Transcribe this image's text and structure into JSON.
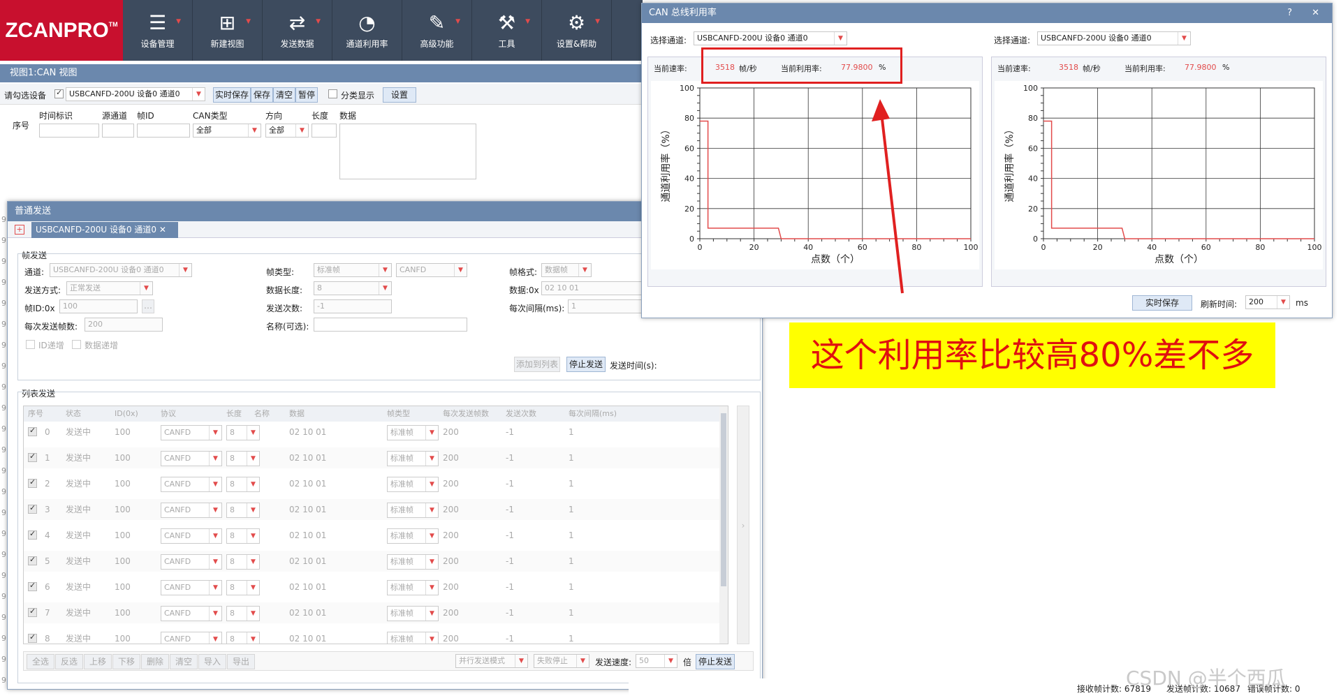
{
  "app": {
    "logo": "ZCANPRO",
    "tm": "TM"
  },
  "toolbar": [
    {
      "label": "设备管理",
      "icon": "device-manage-icon",
      "glyph": "☰"
    },
    {
      "label": "新建视图",
      "icon": "new-view-icon",
      "glyph": "⊞"
    },
    {
      "label": "发送数据",
      "icon": "send-data-icon",
      "glyph": "⇄"
    },
    {
      "label": "通道利用率",
      "icon": "channel-usage-icon",
      "glyph": "◔"
    },
    {
      "label": "高级功能",
      "icon": "advanced-icon",
      "glyph": "✎"
    },
    {
      "label": "工具",
      "icon": "tools-icon",
      "glyph": "⚒"
    },
    {
      "label": "设置&帮助",
      "icon": "settings-icon",
      "glyph": "⚙"
    }
  ],
  "canview": {
    "title": "视图1:CAN 视图",
    "device_label": "请勾选设备",
    "device_value": "USBCANFD-200U 设备0 通道0",
    "buttons": [
      "实时保存",
      "保存",
      "清空",
      "暂停"
    ],
    "classify": "分类显示",
    "settings": "设置",
    "headers": {
      "seq": "序号",
      "time": "时间标识",
      "src": "源通道",
      "frameid": "帧ID",
      "cantype": "CAN类型",
      "dir": "方向",
      "len": "长度",
      "data": "数据"
    },
    "filters": {
      "cantype": "全部",
      "dir": "全部"
    }
  },
  "sendwin": {
    "title": "普通发送",
    "controls": "? — ☐ ✕",
    "tab": "USBCANFD-200U 设备0 通道0",
    "frame_group": "帧发送",
    "channel_label": "通道:",
    "channel_value": "USBCANFD-200U 设备0 通道0",
    "frametype_label": "帧类型:",
    "frametype_value": "标准帧",
    "proto_value": "CANFD",
    "frameformat_label": "帧格式:",
    "frameformat_value": "数据帧",
    "mode_label": "发送方式:",
    "mode_value": "正常发送",
    "datalen_label": "数据长度:",
    "datalen_value": "8",
    "data_label": "数据:0x",
    "data_value": "02 10 01",
    "frameid_label": "帧ID:0x",
    "frameid_value": "100",
    "count_label": "发送次数:",
    "count_value": "-1",
    "interval_label": "每次间隔(ms):",
    "interval_value": "1",
    "perframes_label": "每次发送帧数:",
    "perframes_value": "200",
    "name_label": "名称(可选):",
    "id_inc": "ID递增",
    "data_inc": "数据递增",
    "add_btn": "添加到列表",
    "stop_btn": "停止发送",
    "sendtime_label": "发送时间(s):",
    "list_group": "列表发送",
    "list_headers": [
      "序号",
      "状态",
      "ID(0x)",
      "协议",
      "长度",
      "名称",
      "数据",
      "帧类型",
      "每次发送帧数",
      "发送次数",
      "每次间隔(ms)"
    ],
    "rows": [
      {
        "seq": "0",
        "status": "发送中",
        "id": "100",
        "proto": "CANFD",
        "len": "8",
        "data": "02 10 01",
        "ftype": "标准帧",
        "frames": "200",
        "count": "-1",
        "interval": "1"
      },
      {
        "seq": "1",
        "status": "发送中",
        "id": "100",
        "proto": "CANFD",
        "len": "8",
        "data": "02 10 01",
        "ftype": "标准帧",
        "frames": "200",
        "count": "-1",
        "interval": "1"
      },
      {
        "seq": "2",
        "status": "发送中",
        "id": "100",
        "proto": "CANFD",
        "len": "8",
        "data": "02 10 01",
        "ftype": "标准帧",
        "frames": "200",
        "count": "-1",
        "interval": "1"
      },
      {
        "seq": "3",
        "status": "发送中",
        "id": "100",
        "proto": "CANFD",
        "len": "8",
        "data": "02 10 01",
        "ftype": "标准帧",
        "frames": "200",
        "count": "-1",
        "interval": "1"
      },
      {
        "seq": "4",
        "status": "发送中",
        "id": "100",
        "proto": "CANFD",
        "len": "8",
        "data": "02 10 01",
        "ftype": "标准帧",
        "frames": "200",
        "count": "-1",
        "interval": "1"
      },
      {
        "seq": "5",
        "status": "发送中",
        "id": "100",
        "proto": "CANFD",
        "len": "8",
        "data": "02 10 01",
        "ftype": "标准帧",
        "frames": "200",
        "count": "-1",
        "interval": "1"
      },
      {
        "seq": "6",
        "status": "发送中",
        "id": "100",
        "proto": "CANFD",
        "len": "8",
        "data": "02 10 01",
        "ftype": "标准帧",
        "frames": "200",
        "count": "-1",
        "interval": "1"
      },
      {
        "seq": "7",
        "status": "发送中",
        "id": "100",
        "proto": "CANFD",
        "len": "8",
        "data": "02 10 01",
        "ftype": "标准帧",
        "frames": "200",
        "count": "-1",
        "interval": "1"
      },
      {
        "seq": "8",
        "status": "发送中",
        "id": "100",
        "proto": "CANFD",
        "len": "8",
        "data": "02 10 01",
        "ftype": "标准帧",
        "frames": "200",
        "count": "-1",
        "interval": "1"
      }
    ],
    "bottom_buttons": [
      "全选",
      "反选",
      "上移",
      "下移",
      "删除",
      "清空",
      "导入",
      "导出"
    ],
    "parallel_value": "并行发送模式",
    "fail_value": "失败停止",
    "speed_label": "发送速度:",
    "speed_value": "50",
    "speed_unit": "倍",
    "stop_btn2": "停止发送"
  },
  "buswin": {
    "title": "CAN 总线利用率",
    "controls": "? ✕",
    "panels": [
      {
        "select_label": "选择通道:",
        "select_value": "USBCANFD-200U 设备0 通道0",
        "rate_label": "当前速率:",
        "rate_value": "3518",
        "rate_unit": "帧/秒",
        "util_label": "当前利用率:",
        "util_value": "77.9800",
        "util_unit": "%"
      },
      {
        "select_label": "选择通道:",
        "select_value": "USBCANFD-200U 设备0 通道0",
        "rate_label": "当前速率:",
        "rate_value": "3518",
        "rate_unit": "帧/秒",
        "util_label": "当前利用率:",
        "util_value": "77.9800",
        "util_unit": "%"
      }
    ],
    "save_btn": "实时保存",
    "refresh_label": "刷新时间:",
    "refresh_value": "200",
    "refresh_unit": "ms"
  },
  "annotation": "这个利用率比较高80%差不多",
  "statusbar": {
    "recv": "接收帧计数: 67819",
    "sent": "发送帧计数: 10687",
    "err": "错误帧计数: 0"
  },
  "watermark": "CSDN @半个西瓜",
  "chart_data": [
    {
      "type": "line",
      "xlabel": "点数（个）",
      "ylabel": "通道利用率（%）",
      "xlim": [
        0,
        100
      ],
      "ylim": [
        0,
        100
      ],
      "x_ticks": [
        0,
        20,
        40,
        60,
        80,
        100
      ],
      "y_ticks": [
        0,
        20,
        40,
        60,
        80,
        100
      ],
      "grid": true,
      "series": [
        {
          "color": "#e24b4b",
          "x": [
            0,
            1,
            2,
            3,
            3,
            5,
            10,
            20,
            29,
            30,
            100
          ],
          "y": [
            78,
            78,
            78,
            78,
            7,
            7,
            7,
            7,
            7,
            0,
            0
          ]
        }
      ]
    },
    {
      "type": "line",
      "xlabel": "点数（个）",
      "ylabel": "通道利用率（%）",
      "xlim": [
        0,
        100
      ],
      "ylim": [
        0,
        100
      ],
      "x_ticks": [
        0,
        20,
        40,
        60,
        80,
        100
      ],
      "y_ticks": [
        0,
        20,
        40,
        60,
        80,
        100
      ],
      "grid": true,
      "series": [
        {
          "color": "#e24b4b",
          "x": [
            0,
            1,
            2,
            3,
            3,
            5,
            10,
            20,
            29,
            30,
            100
          ],
          "y": [
            78,
            78,
            78,
            78,
            7,
            7,
            7,
            7,
            7,
            0,
            0
          ]
        }
      ]
    }
  ]
}
